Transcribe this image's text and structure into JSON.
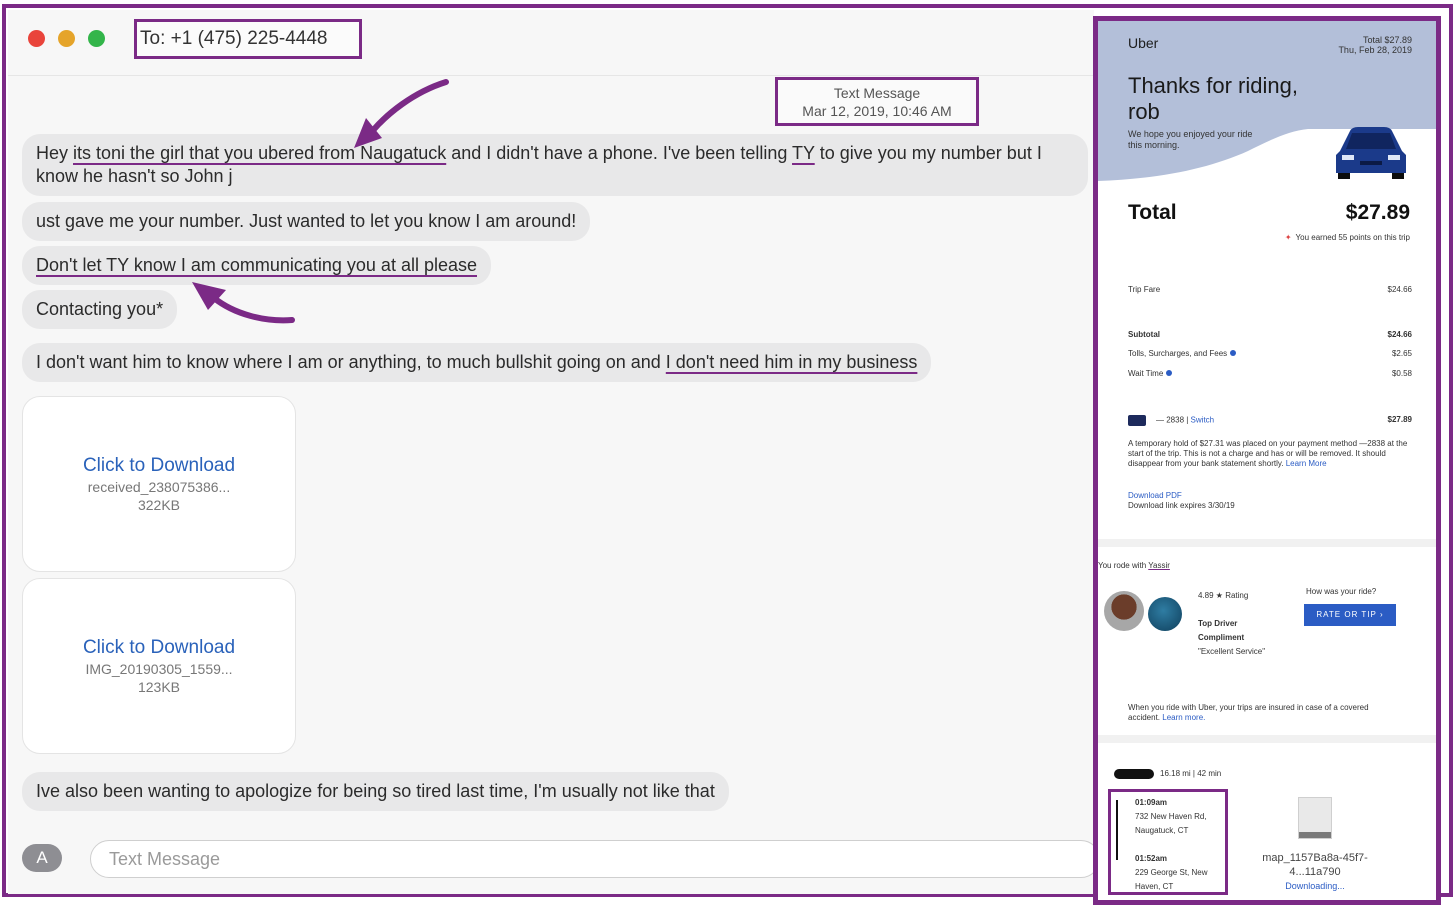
{
  "chat": {
    "recipient": "To: +1 (475) 225-4448",
    "timestamp_title": "Text Message",
    "timestamp_date": "Mar 12, 2019, 10:46 AM",
    "messages": [
      {
        "pre": "Hey ",
        "ul1": "its toni the girl that you ubered from Naugatuck",
        "mid": " and I didn't have a phone. I've been telling ",
        "ul2": "TY",
        "post": " to give you my number but I know he hasn't so John j"
      },
      {
        "text": "ust gave me your number. Just wanted to let you know I am around!"
      },
      {
        "text": "Don't let TY know I am communicating you at all please"
      },
      {
        "text": "Contacting you*"
      },
      {
        "pre": "I don't want him to know where I am or anything,  to much bullshit going on and ",
        "ul": "I don't need him in my business"
      },
      {
        "text": "Ive also been wanting to apologize for being so tired last time, I'm usually not like that"
      }
    ],
    "attachments": [
      {
        "link": "Click to Download",
        "name": "received_238075386...",
        "size": "322KB"
      },
      {
        "link": "Click to Download",
        "name": "IMG_20190305_1559...",
        "size": "123KB"
      }
    ],
    "input_placeholder": "Text Message",
    "apps_button": "A"
  },
  "receipt": {
    "brand": "Uber",
    "top_right_1": "Total $27.89",
    "top_right_2": "Thu, Feb 28, 2019",
    "thanks": "Thanks for riding, rob",
    "subtitle": "We hope you enjoyed your ride this morning.",
    "total_label": "Total",
    "total_value": "$27.89",
    "points": "You earned 55 points on this trip",
    "lines": [
      {
        "label": "Trip Fare",
        "value": "$24.66"
      },
      {
        "label": "Subtotal",
        "value": "$24.66"
      },
      {
        "label": "Tolls, Surcharges, and Fees",
        "value": "$2.65"
      },
      {
        "label": "Wait Time",
        "value": "$0.58"
      }
    ],
    "payment_card": "— 2838 | ",
    "payment_switch": "Switch",
    "payment_value": "$27.89",
    "hold_text": "A temporary hold of $27.31 was placed on your payment method —2838 at the start of the trip. This is not a charge and has or will be removed. It should disappear from your bank statement shortly. ",
    "hold_link": "Learn More",
    "pdf_link": "Download PDF",
    "pdf_expiry": "Download link expires 3/30/19",
    "rode_with_prefix": "You rode with ",
    "driver_name": "Yassir",
    "rating": "4.89 ★ Rating",
    "top_driver": "Top Driver",
    "compliment": "Compliment",
    "compliment_text": "\"Excellent Service\"",
    "how_was": "How was your ride?",
    "rate_button": "RATE OR TIP ›",
    "insurance": "When you ride with Uber, your trips are insured in case of a covered accident. ",
    "insurance_link": "Learn more.",
    "trip_stats": "16.18 mi | 42 min",
    "pickup_time": "01:09am",
    "pickup_address": "732 New Haven Rd, Naugatuck, CT",
    "dropoff_time": "01:52am",
    "dropoff_address": "229 George St, New Haven, CT",
    "map_file": "map_1157Ba8a-45f7-4...11a790",
    "map_status": "Downloading..."
  },
  "colors": {
    "annotation": "#7b2a86",
    "link_blue": "#2a62ba",
    "bubble": "#e8e8e9"
  }
}
